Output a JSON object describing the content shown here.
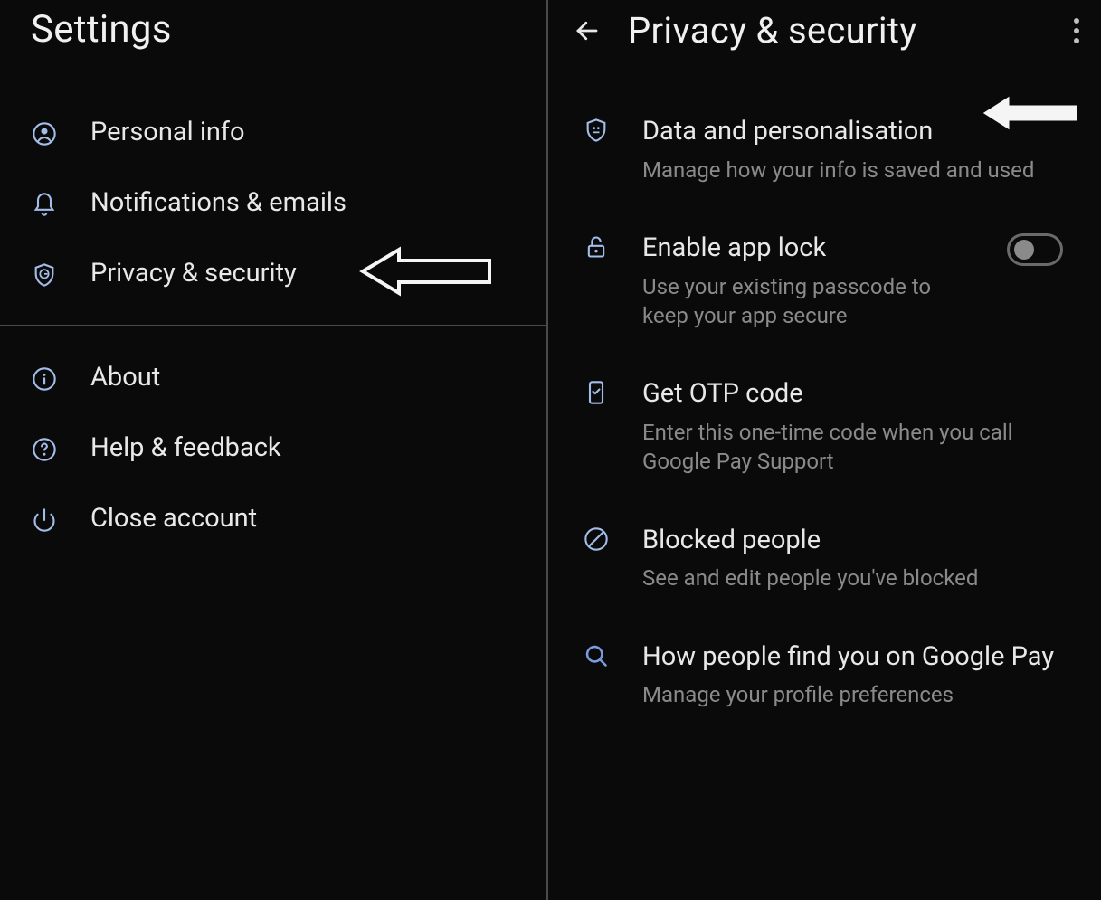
{
  "left": {
    "title": "Settings",
    "items": [
      {
        "label": "Personal info",
        "icon": "person-circle-icon"
      },
      {
        "label": "Notifications & emails",
        "icon": "bell-icon"
      },
      {
        "label": "Privacy & security",
        "icon": "shield-g-icon",
        "pointer": true
      }
    ],
    "secondaryItems": [
      {
        "label": "About",
        "icon": "info-icon"
      },
      {
        "label": "Help & feedback",
        "icon": "help-icon"
      },
      {
        "label": "Close account",
        "icon": "power-icon"
      }
    ]
  },
  "right": {
    "title": "Privacy & security",
    "items": [
      {
        "title": "Data and personalisation",
        "subtitle": "Manage how your info is saved and used",
        "icon": "shield-data-icon",
        "pointer": true
      },
      {
        "title": "Enable app lock",
        "subtitle": "Use your existing passcode to keep your app secure",
        "icon": "lock-icon",
        "toggle": true,
        "toggleOn": false
      },
      {
        "title": "Get OTP code",
        "subtitle": "Enter this one-time code when you call Google Pay Support",
        "icon": "mobile-check-icon"
      },
      {
        "title": "Blocked people",
        "subtitle": "See and edit people you've blocked",
        "icon": "block-icon"
      },
      {
        "title": "How people find you on Google Pay",
        "subtitle": "Manage your profile preferences",
        "icon": "search-icon"
      }
    ]
  },
  "colors": {
    "iconBlue": "#a3bde9",
    "iconBlueAlt": "#7c9be0"
  }
}
